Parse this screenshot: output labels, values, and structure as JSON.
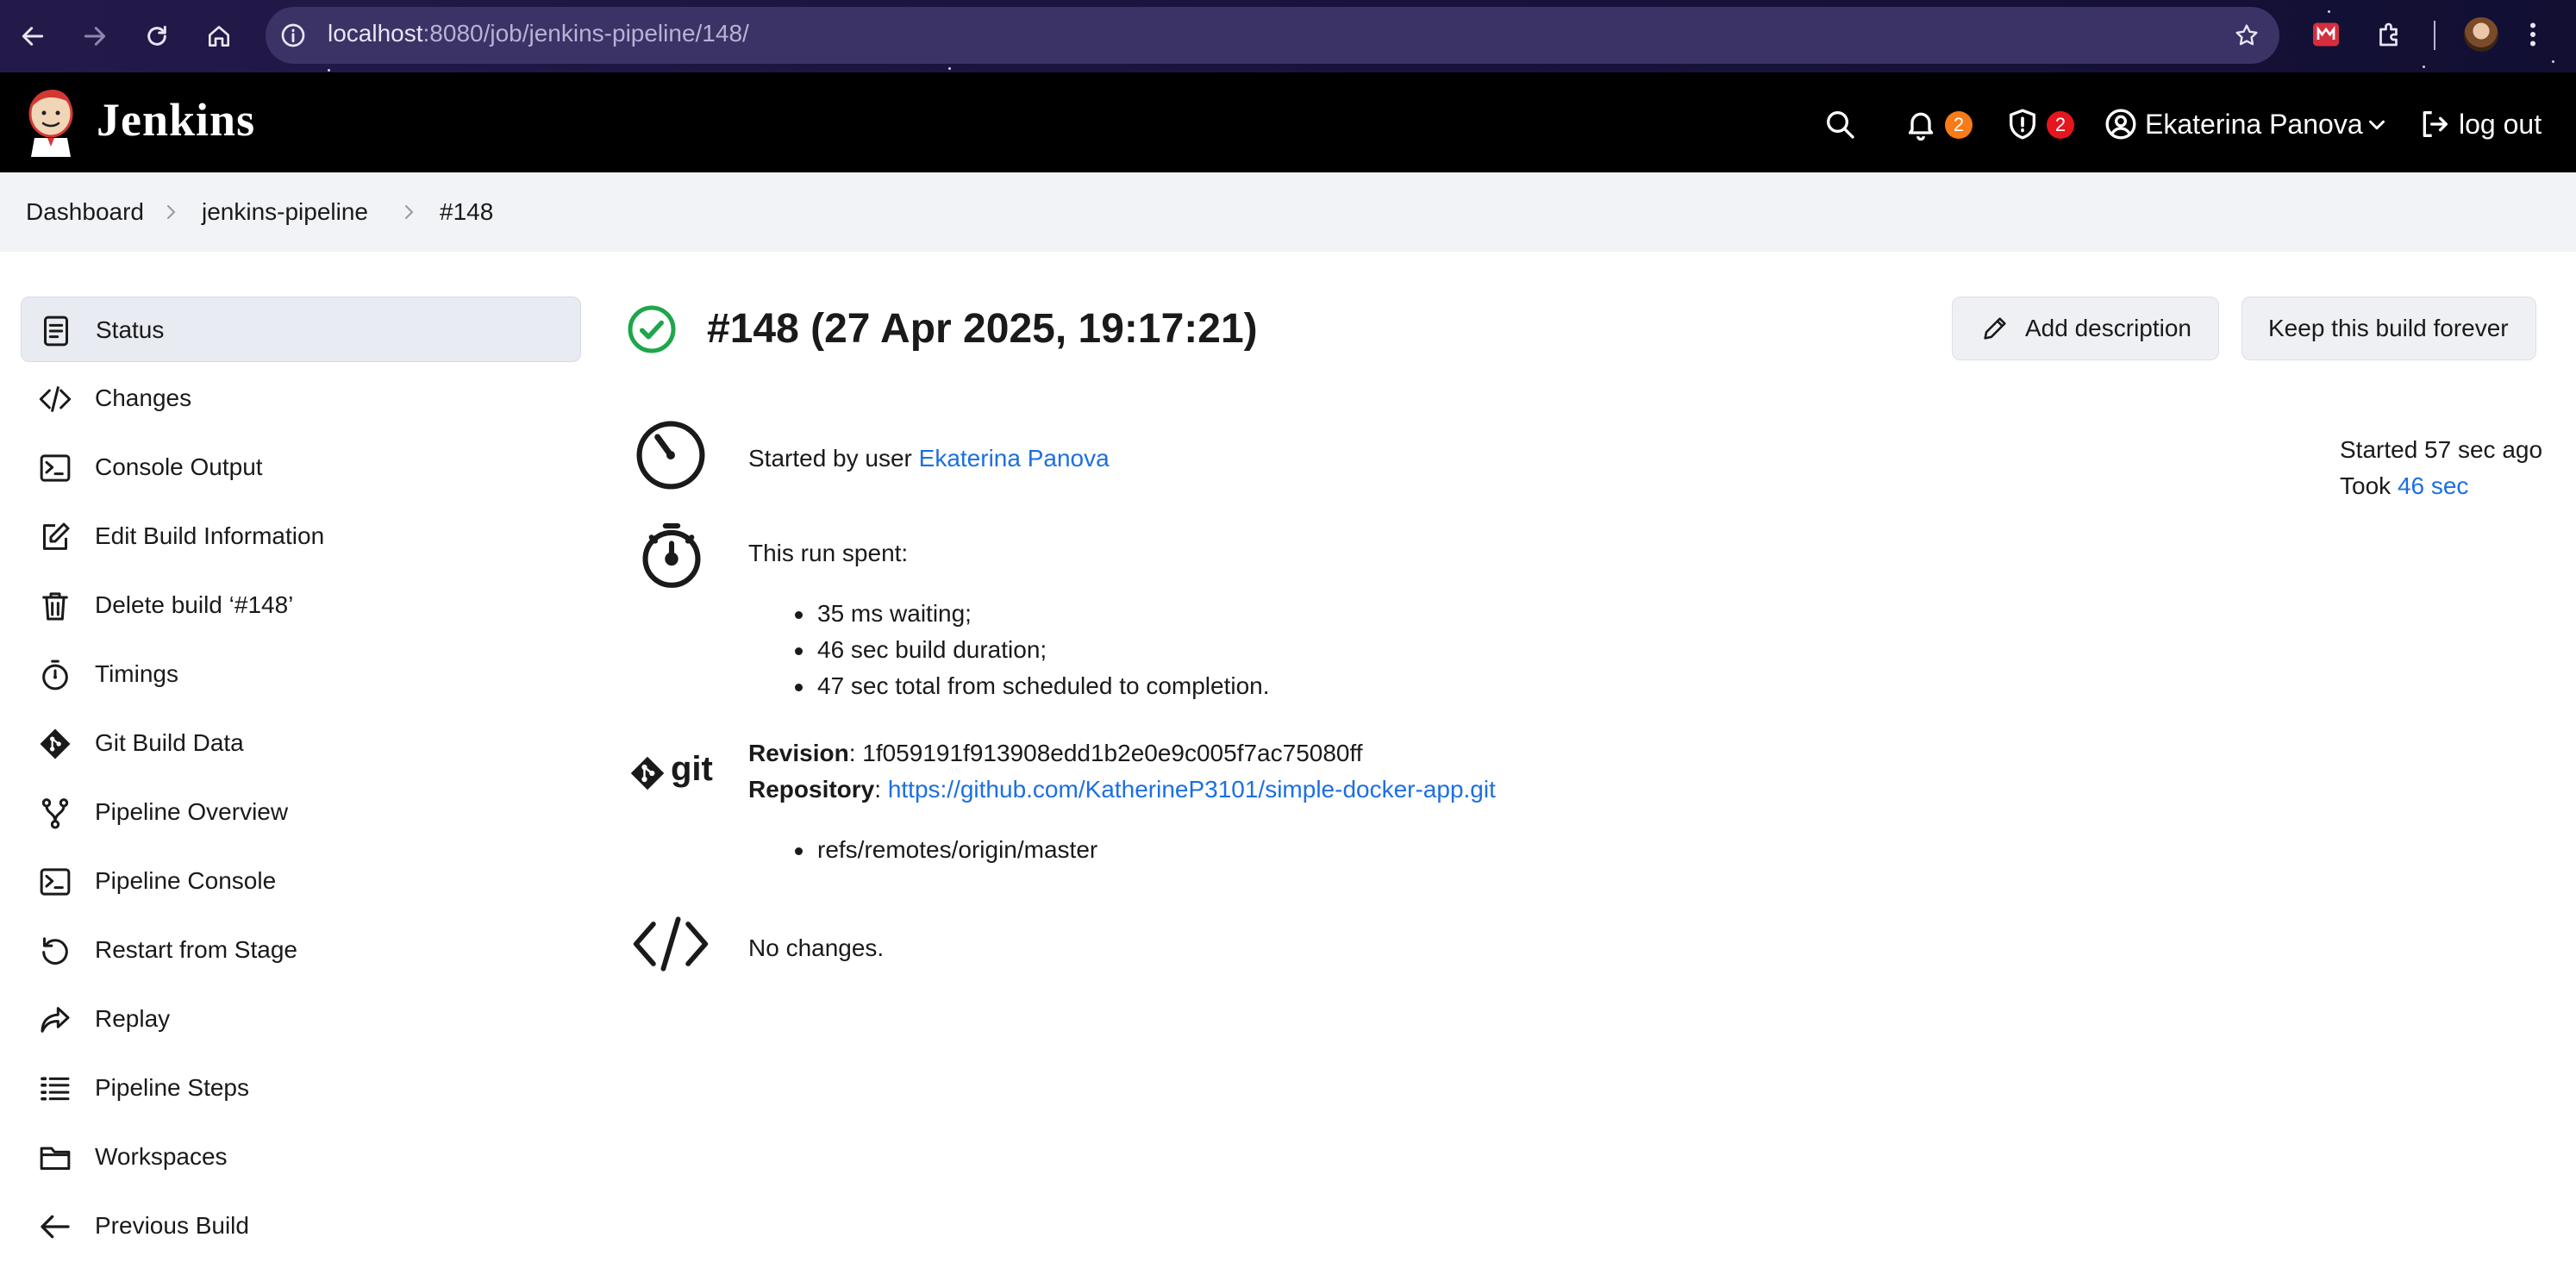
{
  "browser": {
    "url_host": "localhost",
    "url_path": ":8080/job/jenkins-pipeline/148/"
  },
  "header": {
    "app_name": "Jenkins",
    "notifications_count": "2",
    "security_count": "2",
    "user_name": "Ekaterina Panova",
    "logout_label": "log out",
    "colors": {
      "bg": "#000000",
      "notif_badge": "#f77b18",
      "security_badge": "#e5161e"
    }
  },
  "breadcrumb": {
    "items": [
      "Dashboard",
      "jenkins-pipeline",
      "#148"
    ]
  },
  "sidebar": {
    "items": [
      {
        "label": "Status",
        "icon": "document-icon",
        "active": true
      },
      {
        "label": "Changes",
        "icon": "code-icon"
      },
      {
        "label": "Console Output",
        "icon": "terminal-icon"
      },
      {
        "label": "Edit Build Information",
        "icon": "edit-icon"
      },
      {
        "label": "Delete build ‘#148’",
        "icon": "trash-icon"
      },
      {
        "label": "Timings",
        "icon": "stopwatch-icon"
      },
      {
        "label": "Git Build Data",
        "icon": "git-icon"
      },
      {
        "label": "Pipeline Overview",
        "icon": "branch-icon"
      },
      {
        "label": "Pipeline Console",
        "icon": "terminal-icon"
      },
      {
        "label": "Restart from Stage",
        "icon": "restart-icon"
      },
      {
        "label": "Replay",
        "icon": "replay-icon"
      },
      {
        "label": "Pipeline Steps",
        "icon": "list-icon"
      },
      {
        "label": "Workspaces",
        "icon": "folder-icon"
      },
      {
        "label": "Previous Build",
        "icon": "arrow-left-icon"
      }
    ]
  },
  "main": {
    "title": "#148 (27 Apr 2025, 19:17:21)",
    "status_color": "#1ea64b",
    "add_description": "Add description",
    "keep_forever": "Keep this build forever",
    "started_by_prefix": "Started by user ",
    "started_by_user": "Ekaterina Panova",
    "started_ago": "Started 57 sec ago",
    "took_prefix": "Took ",
    "took_value": "46 sec",
    "run_spent": "This run spent:",
    "timings": [
      "35 ms waiting;",
      "46 sec build duration;",
      "47 sec total from scheduled to completion."
    ],
    "git_logo_text": "git",
    "revision_label": "Revision",
    "revision_value": ": 1f059191f913908edd1b2e0e9c005f7ac75080ff",
    "repository_label": "Repository",
    "repository_sep": ": ",
    "repository_url": "https://github.com/KatherineP3101/simple-docker-app.git",
    "refs": [
      "refs/remotes/origin/master"
    ],
    "no_changes": "No changes."
  }
}
